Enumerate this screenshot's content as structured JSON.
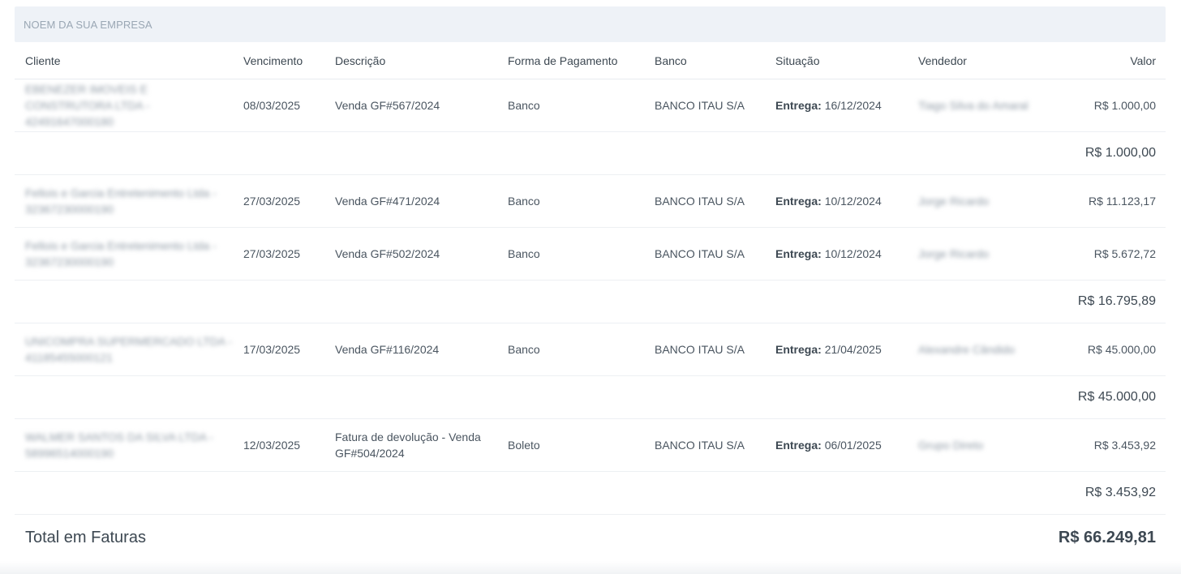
{
  "company": {
    "name": "NOEM DA SUA EMPRESA"
  },
  "columns": {
    "cliente": "Cliente",
    "vencimento": "Vencimento",
    "descricao": "Descrição",
    "forma": "Forma de Pagamento",
    "banco": "Banco",
    "situacao": "Situação",
    "vendedor": "Vendedor",
    "valor": "Valor"
  },
  "groups": [
    {
      "rows": [
        {
          "cliente": "EBENEZER IMOVEIS E CONSTRUTORA LTDA - 42491647000180",
          "vencimento": "08/03/2025",
          "descricao": "Venda GF#567/2024",
          "forma": "Banco",
          "banco": "BANCO ITAU S/A",
          "situacao_label": "Entrega:",
          "situacao_value": "16/12/2024",
          "vendedor": "Tiago Silva do Amaral",
          "valor": "R$ 1.000,00"
        }
      ],
      "subtotal": "R$ 1.000,00"
    },
    {
      "rows": [
        {
          "cliente": "Fellois e Garcia Entretenimento Ltda - 32367230000190",
          "vencimento": "27/03/2025",
          "descricao": "Venda GF#471/2024",
          "forma": "Banco",
          "banco": "BANCO ITAU S/A",
          "situacao_label": "Entrega:",
          "situacao_value": "10/12/2024",
          "vendedor": "Jorge Ricardo",
          "valor": "R$ 11.123,17"
        },
        {
          "cliente": "Fellois e Garcia Entretenimento Ltda - 32367230000190",
          "vencimento": "27/03/2025",
          "descricao": "Venda GF#502/2024",
          "forma": "Banco",
          "banco": "BANCO ITAU S/A",
          "situacao_label": "Entrega:",
          "situacao_value": "10/12/2024",
          "vendedor": "Jorge Ricardo",
          "valor": "R$ 5.672,72"
        }
      ],
      "subtotal": "R$ 16.795,89"
    },
    {
      "rows": [
        {
          "cliente": "UNICOMPRA SUPERMERCADO LTDA - 41185455000121",
          "vencimento": "17/03/2025",
          "descricao": "Venda GF#116/2024",
          "forma": "Banco",
          "banco": "BANCO ITAU S/A",
          "situacao_label": "Entrega:",
          "situacao_value": "21/04/2025",
          "vendedor": "Alexandre Cândido",
          "valor": "R$ 45.000,00"
        }
      ],
      "subtotal": "R$ 45.000,00"
    },
    {
      "rows": [
        {
          "cliente": "WALMER SANTOS DA SILVA LTDA - 58996514000190",
          "vencimento": "12/03/2025",
          "descricao": "Fatura de devolução - Venda GF#504/2024",
          "forma": "Boleto",
          "banco": "BANCO ITAU S/A",
          "situacao_label": "Entrega:",
          "situacao_value": "06/01/2025",
          "vendedor": "Grupo Direto",
          "valor": "R$ 3.453,92"
        }
      ],
      "subtotal": "R$ 3.453,92"
    }
  ],
  "total": {
    "label": "Total em Faturas",
    "value": "R$ 66.249,81"
  }
}
